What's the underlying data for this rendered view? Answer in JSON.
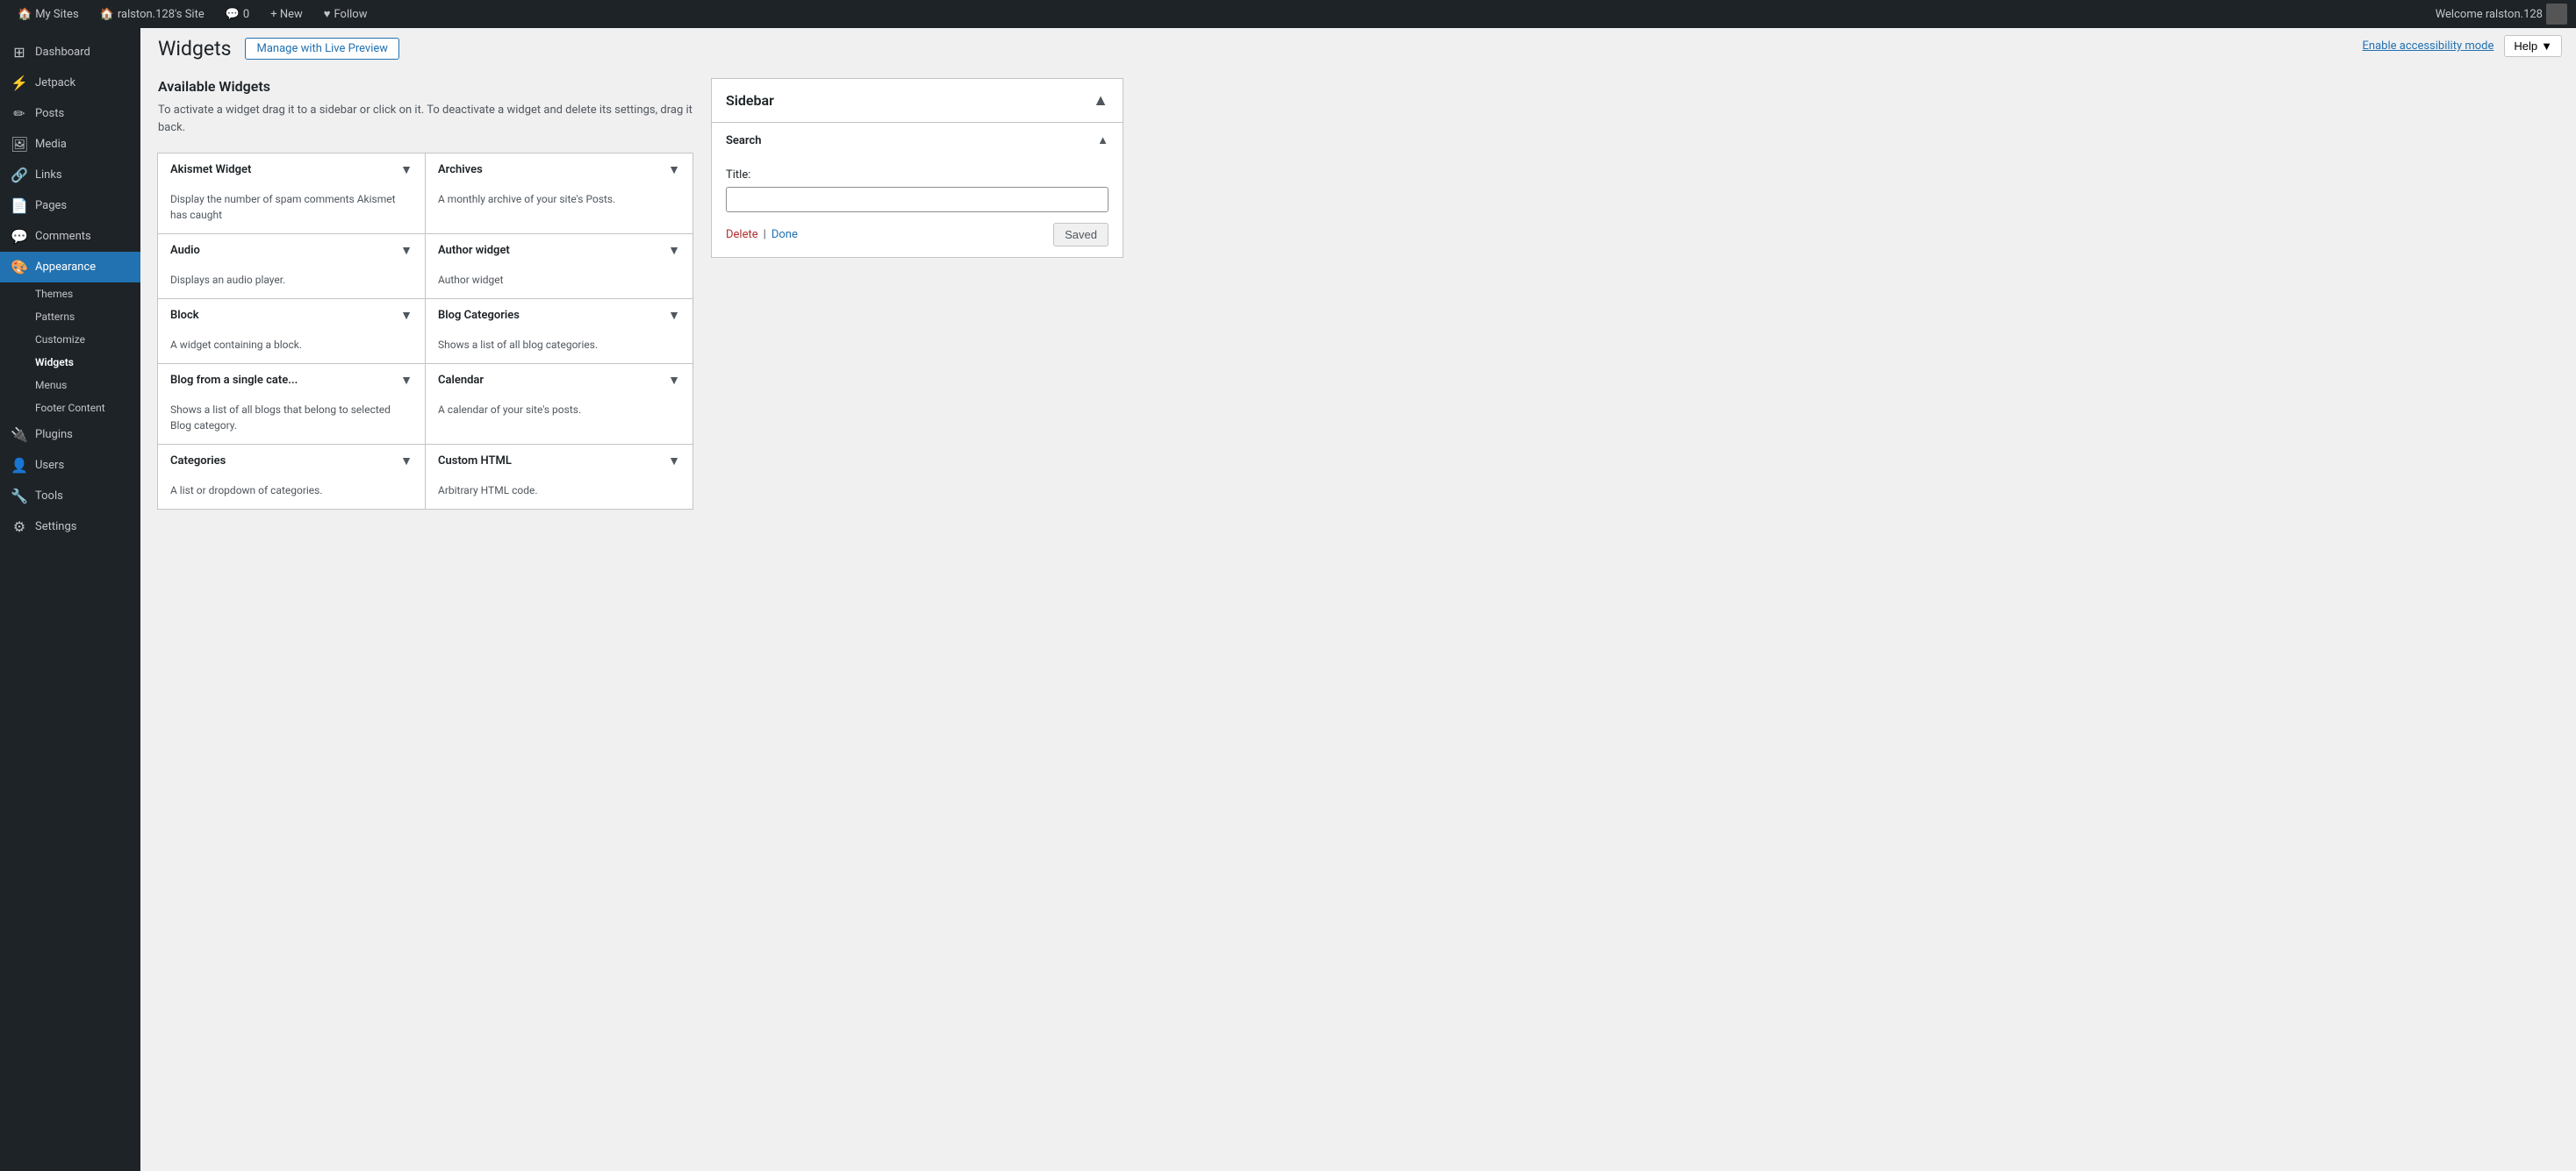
{
  "adminbar": {
    "my_sites": "My Sites",
    "site_name": "ralston.128's Site",
    "comments_label": "Comments",
    "comments_count": "0",
    "new_label": "+ New",
    "follow_label": "Follow",
    "welcome": "Welcome ralston.128"
  },
  "screen_options": {
    "enable_accessibility": "Enable accessibility mode",
    "help": "Help"
  },
  "sidebar_nav": {
    "items": [
      {
        "id": "dashboard",
        "label": "Dashboard",
        "icon": "⊞"
      },
      {
        "id": "jetpack",
        "label": "Jetpack",
        "icon": "⚡"
      },
      {
        "id": "posts",
        "label": "Posts",
        "icon": "📝"
      },
      {
        "id": "media",
        "label": "Media",
        "icon": "🖼"
      },
      {
        "id": "links",
        "label": "Links",
        "icon": "🔗"
      },
      {
        "id": "pages",
        "label": "Pages",
        "icon": "📄"
      },
      {
        "id": "comments",
        "label": "Comments",
        "icon": "💬"
      },
      {
        "id": "appearance",
        "label": "Appearance",
        "icon": "🎨",
        "active": true
      },
      {
        "id": "plugins",
        "label": "Plugins",
        "icon": "🔌"
      },
      {
        "id": "users",
        "label": "Users",
        "icon": "👤"
      },
      {
        "id": "tools",
        "label": "Tools",
        "icon": "🔧"
      },
      {
        "id": "settings",
        "label": "Settings",
        "icon": "⚙"
      }
    ],
    "appearance_submenu": [
      {
        "id": "themes",
        "label": "Themes"
      },
      {
        "id": "patterns",
        "label": "Patterns"
      },
      {
        "id": "customize",
        "label": "Customize"
      },
      {
        "id": "widgets",
        "label": "Widgets",
        "active": true
      },
      {
        "id": "menus",
        "label": "Menus"
      },
      {
        "id": "footer-content",
        "label": "Footer Content"
      }
    ]
  },
  "page": {
    "title": "Widgets",
    "manage_button": "Manage with Live Preview",
    "available_widgets_title": "Available Widgets",
    "available_widgets_desc": "To activate a widget drag it to a sidebar or click on it. To deactivate a widget and delete its settings, drag it back."
  },
  "widgets": [
    {
      "id": "akismet",
      "name": "Akismet Widget",
      "desc": "Display the number of spam comments Akismet has caught"
    },
    {
      "id": "archives",
      "name": "Archives",
      "desc": "A monthly archive of your site's Posts."
    },
    {
      "id": "audio",
      "name": "Audio",
      "desc": "Displays an audio player."
    },
    {
      "id": "author-widget",
      "name": "Author widget",
      "desc": "Author widget"
    },
    {
      "id": "block",
      "name": "Block",
      "desc": "A widget containing a block."
    },
    {
      "id": "blog-categories",
      "name": "Blog Categories",
      "desc": "Shows a list of all blog categories."
    },
    {
      "id": "blog-single-cat",
      "name": "Blog from a single cate...",
      "desc": "Shows a list of all blogs that belong to selected Blog category."
    },
    {
      "id": "calendar",
      "name": "Calendar",
      "desc": "A calendar of your site's posts."
    },
    {
      "id": "categories",
      "name": "Categories",
      "desc": "A list or dropdown of categories."
    },
    {
      "id": "custom-html",
      "name": "Custom HTML",
      "desc": "Arbitrary HTML code."
    }
  ],
  "sidebar_panel": {
    "title": "Sidebar",
    "search_widget": {
      "title": "Search",
      "field_label": "Title:",
      "field_placeholder": "",
      "delete_label": "Delete",
      "separator": "|",
      "done_label": "Done",
      "saved_label": "Saved"
    }
  }
}
